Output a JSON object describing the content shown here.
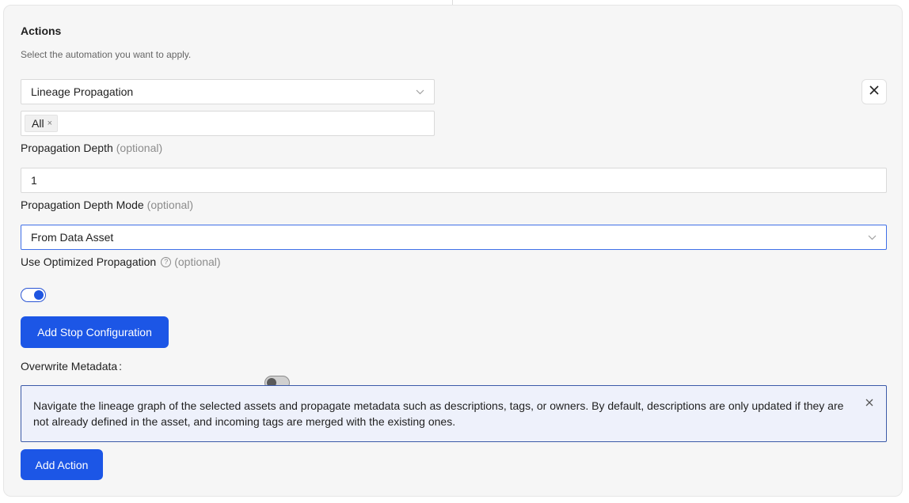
{
  "section": {
    "title": "Actions",
    "subtitle": "Select the automation you want to apply."
  },
  "action_select": {
    "value": "Lineage Propagation"
  },
  "selected_tags": [
    {
      "label": "All"
    }
  ],
  "propagation_depth": {
    "label": "Propagation Depth",
    "optional": "(optional)",
    "value": "1"
  },
  "propagation_depth_mode": {
    "label": "Propagation Depth Mode",
    "optional": "(optional)",
    "value": "From Data Asset"
  },
  "optimized_propagation": {
    "label": "Use Optimized Propagation",
    "optional": "(optional)",
    "help_icon": "?",
    "enabled": true
  },
  "add_stop_configuration": {
    "label": "Add Stop Configuration"
  },
  "overwrite_metadata": {
    "label": "Overwrite Metadata",
    "colon": ":",
    "enabled": false
  },
  "info": {
    "text": "Navigate the lineage graph of the selected assets and propagate metadata such as descriptions, tags, or owners. By default, descriptions are only updated if they are not already defined in the asset, and incoming tags are merged with the existing ones."
  },
  "add_action": {
    "label": "Add Action"
  },
  "icons": {
    "remove": "close-icon",
    "dropdown": "chevron-down-icon",
    "help": "question-circle-icon",
    "tag_remove": "×"
  },
  "colors": {
    "primary": "#1c56e6",
    "info_bg": "#eef1fb",
    "info_border": "#3c5aa8"
  }
}
